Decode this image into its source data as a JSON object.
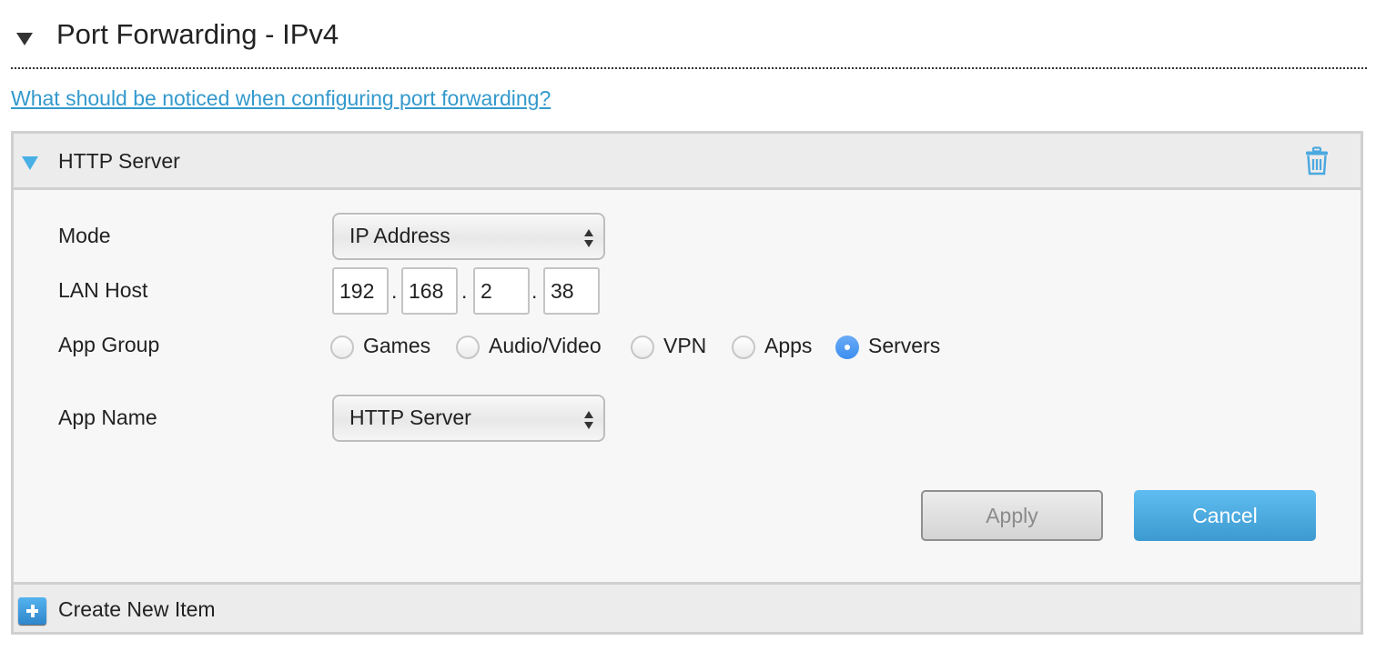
{
  "section": {
    "title": "Port Forwarding - IPv4",
    "toggle_icon": "triangle-down-icon"
  },
  "help_link": "What should be noticed when configuring port forwarding?",
  "item": {
    "title": "HTTP Server",
    "toggle_icon": "triangle-down-icon",
    "delete_icon": "trash-icon",
    "form": {
      "mode": {
        "label": "Mode",
        "value": "IP Address"
      },
      "lan_host": {
        "label": "LAN Host",
        "octets": [
          "192",
          "168",
          "2",
          "38"
        ],
        "separator": "."
      },
      "app_group": {
        "label": "App Group",
        "options": [
          {
            "label": "Games",
            "checked": false
          },
          {
            "label": "Audio/Video",
            "checked": false
          },
          {
            "label": "VPN",
            "checked": false
          },
          {
            "label": "Apps",
            "checked": false
          },
          {
            "label": "Servers",
            "checked": true
          }
        ],
        "selected": "Servers"
      },
      "app_name": {
        "label": "App Name",
        "value": "HTTP Server"
      }
    },
    "buttons": {
      "apply": "Apply",
      "cancel": "Cancel"
    }
  },
  "create_new": {
    "label": "Create New Item",
    "icon": "plus-icon"
  },
  "colors": {
    "accent": "#3399cc",
    "cancel_button": "#4aa8e0",
    "radio_checked": "#4a94f2",
    "panel_border": "#d0d0d0"
  }
}
